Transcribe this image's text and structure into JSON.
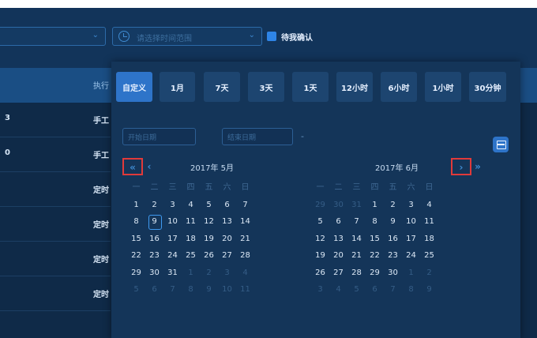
{
  "toolbar": {
    "range_placeholder": "请选择时间范围",
    "confirm_checkbox_label": "待我确认"
  },
  "table": {
    "column_header": "执行",
    "rows": [
      {
        "c1": "3",
        "c2": "手工"
      },
      {
        "c1": "0",
        "c2": "手工"
      },
      {
        "c1": "",
        "c2": "定时"
      },
      {
        "c1": "",
        "c2": "定时"
      },
      {
        "c1": "",
        "c2": "定时"
      },
      {
        "c1": "",
        "c2": "定时"
      }
    ]
  },
  "picker": {
    "quick_ranges": [
      "自定义",
      "1月",
      "7天",
      "3天",
      "1天",
      "12小时",
      "6小时",
      "1小时",
      "30分钟"
    ],
    "active_quick": "自定义",
    "start_placeholder": "开始日期",
    "end_placeholder": "结束日期",
    "range_dash": "-",
    "nav": {
      "prev_year": "«",
      "prev_month": "‹",
      "next_month": "›",
      "next_year": "»"
    },
    "left_month": "2017年 5月",
    "right_month": "2017年 6月",
    "weekdays": [
      "一",
      "二",
      "三",
      "四",
      "五",
      "六",
      "日"
    ],
    "left_days": [
      [
        "1",
        "2",
        "3",
        "4",
        "5",
        "6",
        "7"
      ],
      [
        "8",
        "9",
        "10",
        "11",
        "12",
        "13",
        "14"
      ],
      [
        "15",
        "16",
        "17",
        "18",
        "19",
        "20",
        "21"
      ],
      [
        "22",
        "23",
        "24",
        "25",
        "26",
        "27",
        "28"
      ],
      [
        "29",
        "30",
        "31",
        "1",
        "2",
        "3",
        "4"
      ],
      [
        "5",
        "6",
        "7",
        "8",
        "9",
        "10",
        "11"
      ]
    ],
    "right_days": [
      [
        "29",
        "30",
        "31",
        "1",
        "2",
        "3",
        "4"
      ],
      [
        "5",
        "6",
        "7",
        "8",
        "9",
        "10",
        "11"
      ],
      [
        "12",
        "13",
        "14",
        "15",
        "16",
        "17",
        "18"
      ],
      [
        "19",
        "20",
        "21",
        "22",
        "23",
        "24",
        "25"
      ],
      [
        "26",
        "27",
        "28",
        "29",
        "30",
        "1",
        "2"
      ],
      [
        "3",
        "4",
        "5",
        "6",
        "7",
        "8",
        "9"
      ]
    ],
    "today": "9"
  }
}
